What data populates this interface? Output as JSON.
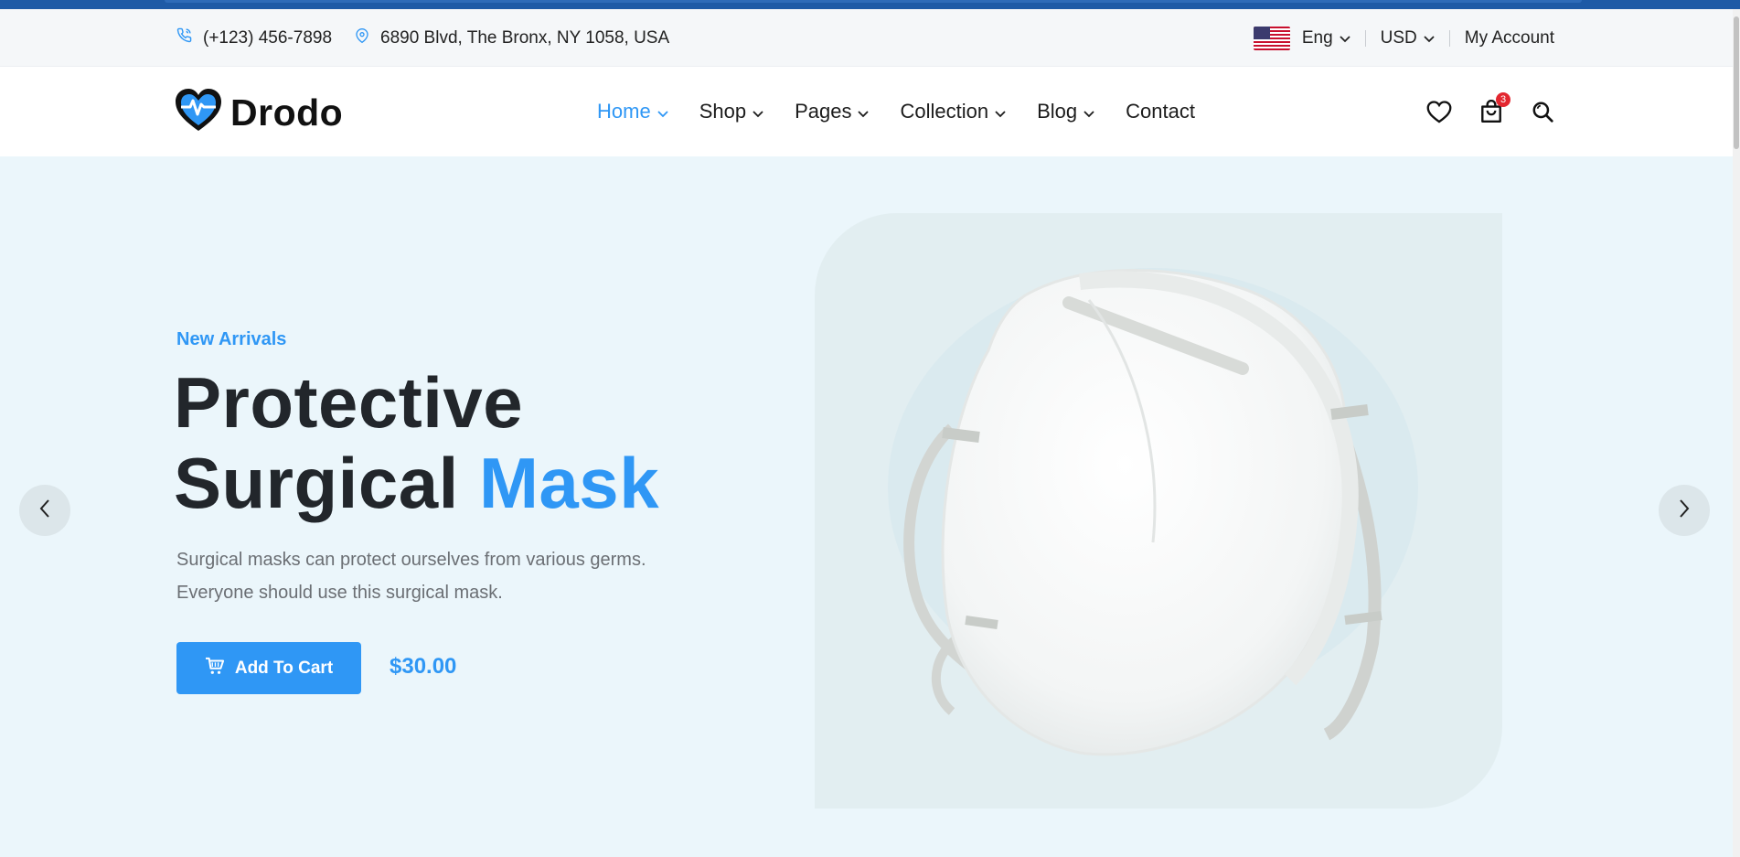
{
  "topbar": {
    "phone": "(+123) 456-7898",
    "address": "6890 Blvd, The Bronx, NY 1058, USA",
    "language": "Eng",
    "currency": "USD",
    "account": "My Account",
    "icons": {
      "phone": "phone-icon",
      "location": "map-pin-icon",
      "flag": "us-flag-icon"
    }
  },
  "header": {
    "logo_text": "Drodo",
    "nav": [
      {
        "label": "Home",
        "has_dropdown": true,
        "active": true
      },
      {
        "label": "Shop",
        "has_dropdown": true,
        "active": false
      },
      {
        "label": "Pages",
        "has_dropdown": true,
        "active": false
      },
      {
        "label": "Collection",
        "has_dropdown": true,
        "active": false
      },
      {
        "label": "Blog",
        "has_dropdown": true,
        "active": false
      },
      {
        "label": "Contact",
        "has_dropdown": false,
        "active": false
      }
    ],
    "cart_count": "3",
    "icons": [
      "heart-icon",
      "shopping-bag-icon",
      "search-icon"
    ]
  },
  "hero": {
    "subtitle": "New Arrivals",
    "title_line1": "Protective",
    "title_line2_plain": "Surgical ",
    "title_line2_accent": "Mask",
    "description_line1": "Surgical masks can protect ourselves from various germs.",
    "description_line2": "Everyone should use this surgical mask.",
    "button_label": "Add To Cart",
    "price": "$30.00"
  },
  "colors": {
    "accent": "#2f97f5",
    "hero_bg": "#ebf6fb",
    "dark_text": "#22262b",
    "badge": "#e3262f"
  }
}
